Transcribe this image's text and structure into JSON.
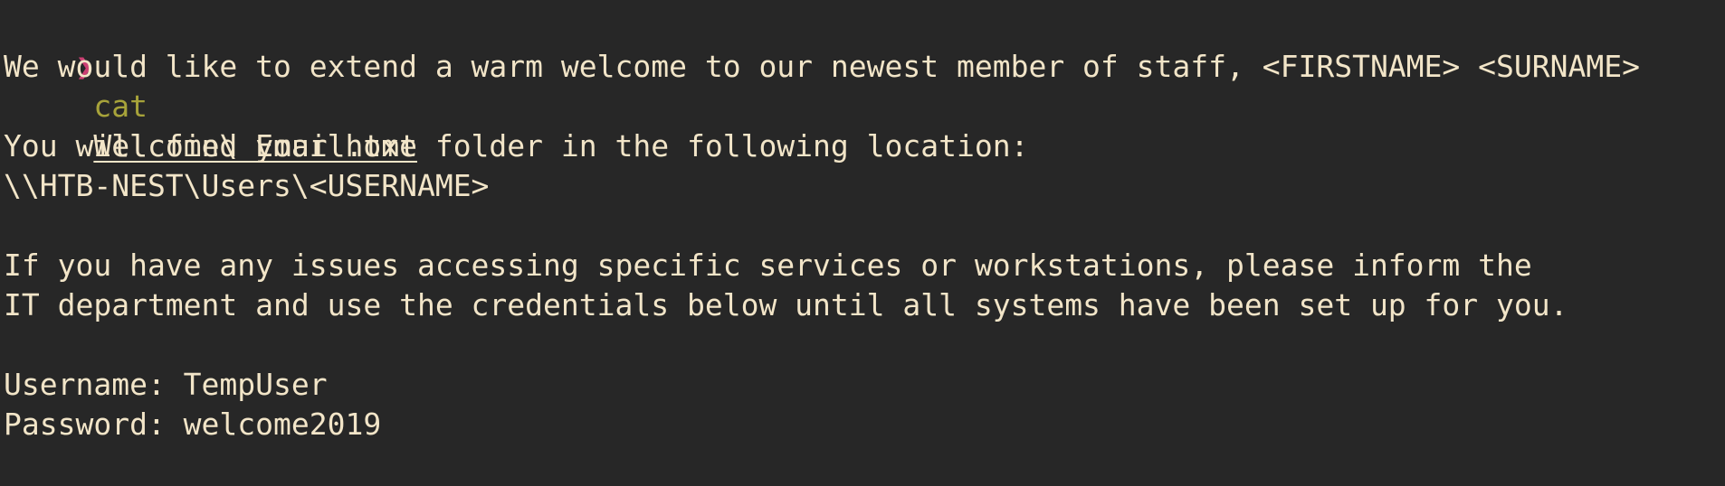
{
  "prompt": {
    "symbol": "❯",
    "command": "cat",
    "argument": "Welcome\\ Email.txt"
  },
  "output": {
    "line1": "We would like to extend a warm welcome to our newest member of staff, <FIRSTNAME> <SURNAME>",
    "line2": "You will find your home folder in the following location:",
    "line3": "\\\\HTB-NEST\\Users\\<USERNAME>",
    "line4": "If you have any issues accessing specific services or workstations, please inform the",
    "line5": "IT department and use the credentials below until all systems have been set up for you.",
    "line6": "Username: TempUser",
    "line7": "Password: welcome2019"
  },
  "colors": {
    "background": "#272727",
    "text": "#f2e5c8",
    "prompt_symbol": "#cc3f73",
    "command": "#a7a33a"
  }
}
